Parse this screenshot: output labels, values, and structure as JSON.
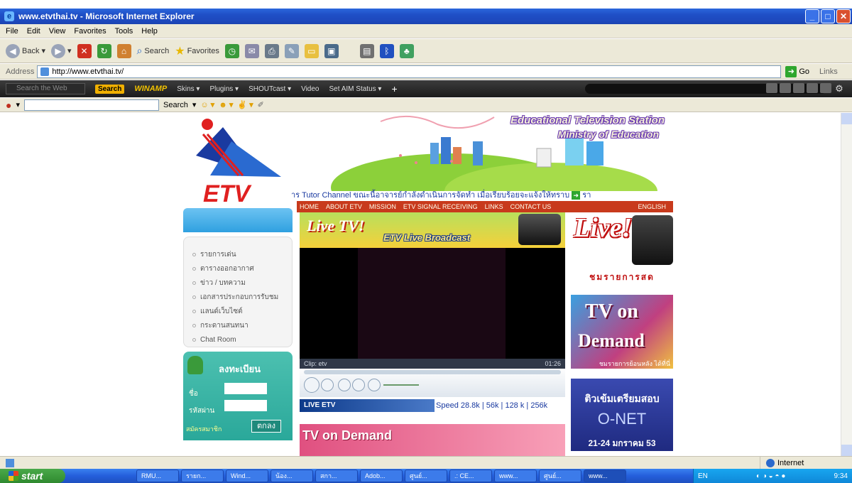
{
  "window": {
    "title": "www.etvthai.tv - Microsoft Internet Explorer"
  },
  "menu": [
    "File",
    "Edit",
    "View",
    "Favorites",
    "Tools",
    "Help"
  ],
  "toolbar": {
    "back_label": "Back",
    "search_label": "Search",
    "favorites_label": "Favorites"
  },
  "address": {
    "label": "Address",
    "url": "http://www.etvthai.tv/",
    "go_label": "Go",
    "links_label": "Links"
  },
  "winamp": {
    "search_placeholder": "Search the Web",
    "search_button": "Search",
    "brand": "WINAMP",
    "items": [
      "Skins ▾",
      "Plugins ▾",
      "SHOUTcast ▾",
      "Video",
      "Set AIM Status ▾"
    ]
  },
  "extbar": {
    "search_label": "Search"
  },
  "site": {
    "logo_text": "ETV",
    "banner_line1": "Educational Television Station",
    "banner_line2": "Ministry of Education",
    "marquee": "าร Tutor Channel ขณะนี้อาจารย์กำลังดำเนินการจัดทำ เมื่อเรียบร้อยจะแจ้งให้ทราบ",
    "marquee_tail": "รา",
    "nav": [
      "HOME",
      "ABOUT ETV",
      "MISSION",
      "ETV SIGNAL RECEIVING",
      "LINKS",
      "CONTACT US"
    ],
    "nav_english": "ENGLISH",
    "left_menu": [
      "รายการเด่น",
      "ตารางออกอากาศ",
      "ข่าว / บทความ",
      "เอกสารประกอบการรับชม",
      "แลนด์เว็บไซต์",
      "กระดานสนทนา",
      "Chat Room"
    ],
    "login": {
      "heading": "ลงทะเบียน",
      "name_label": "ชื่อ",
      "password_label": "รหัสผ่าน",
      "submit": "ตกลง",
      "register": "สมัครสมาชิก"
    },
    "player": {
      "live_title": "Live TV!",
      "live_subtitle": "ETV Live Broadcast",
      "clip": "Clip: etv",
      "time": "01:26",
      "live_tag": "LIVE ETV",
      "speed": "Speed  28.8k | 56k | 128 k | 256k"
    },
    "right": {
      "live_big": "Live!",
      "live_caption": "ชมรายการสด",
      "tvod_1": "TV on",
      "tvod_2": "Demand",
      "tvod_3": "ชมรายการย้อนหลัง ได้ที่นี่",
      "onet_1": "ติวเข้มเตรียมสอบ",
      "onet_2": "O-NET",
      "onet_3": "21-24 มกราคม 53"
    },
    "strip_text": "TV on Demand"
  },
  "status": {
    "zone": "Internet"
  },
  "taskbar": {
    "start": "start",
    "tasks": [
      "RMU...",
      "รายก...",
      "Wind...",
      "น้อง...",
      "สกา...",
      "Adob...",
      "ศูนย์...",
      ".: CE...",
      "www...",
      "ศูนย์...",
      "www..."
    ],
    "tray_lang": "EN",
    "clock": "9:34"
  }
}
